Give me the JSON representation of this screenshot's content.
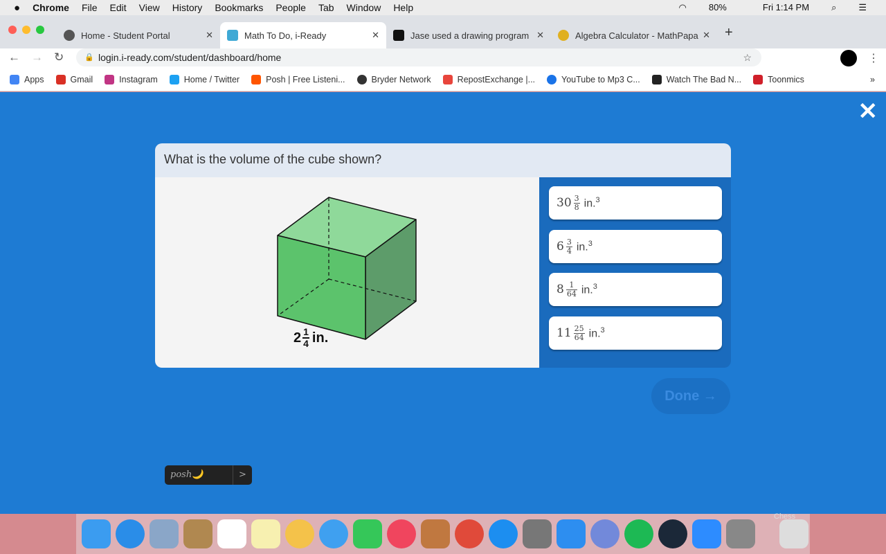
{
  "menubar": {
    "app": "Chrome",
    "items": [
      "File",
      "Edit",
      "View",
      "History",
      "Bookmarks",
      "People",
      "Tab",
      "Window",
      "Help"
    ],
    "battery": "80%",
    "clock": "Fri 1:14 PM"
  },
  "tabs": [
    {
      "title": "Home - Student Portal",
      "color": "#555"
    },
    {
      "title": "Math To Do, i-Ready",
      "color": "#3fa9d5"
    },
    {
      "title": "Jase used a drawing program c",
      "color": "#111"
    },
    {
      "title": "Algebra Calculator - MathPapa",
      "color": "#e0b020"
    }
  ],
  "url": "login.i-ready.com/student/dashboard/home",
  "bookmarks": [
    {
      "label": "Apps",
      "color": "#4285f4"
    },
    {
      "label": "Gmail",
      "color": "#d93025"
    },
    {
      "label": "Instagram",
      "color": "#c13584"
    },
    {
      "label": "Home / Twitter",
      "color": "#1da1f2"
    },
    {
      "label": "Posh | Free Listeni...",
      "color": "#ff5500"
    },
    {
      "label": "Bryder Network",
      "color": "#333"
    },
    {
      "label": "RepostExchange |...",
      "color": "#e8453c"
    },
    {
      "label": "YouTube to Mp3 C...",
      "color": "#1a73e8"
    },
    {
      "label": "Watch The Bad N...",
      "color": "#222"
    },
    {
      "label": "Toonmics",
      "color": "#d0202a"
    }
  ],
  "question": "What is the volume of the cube shown?",
  "figure": {
    "label_whole": "2",
    "label_num": "1",
    "label_den": "4",
    "label_unit": "in."
  },
  "options": [
    {
      "whole": "30",
      "num": "3",
      "den": "8",
      "unit": "in.",
      "exp": "3"
    },
    {
      "whole": "6",
      "num": "3",
      "den": "4",
      "unit": "in.",
      "exp": "3"
    },
    {
      "whole": "8",
      "num": "1",
      "den": "64",
      "unit": "in.",
      "exp": "3"
    },
    {
      "whole": "11",
      "num": "25",
      "den": "64",
      "unit": "in.",
      "exp": "3"
    }
  ],
  "done_label": "Done →",
  "posh": {
    "label": "posh🌙",
    "arrow": ">"
  },
  "dock_label": "Chess"
}
